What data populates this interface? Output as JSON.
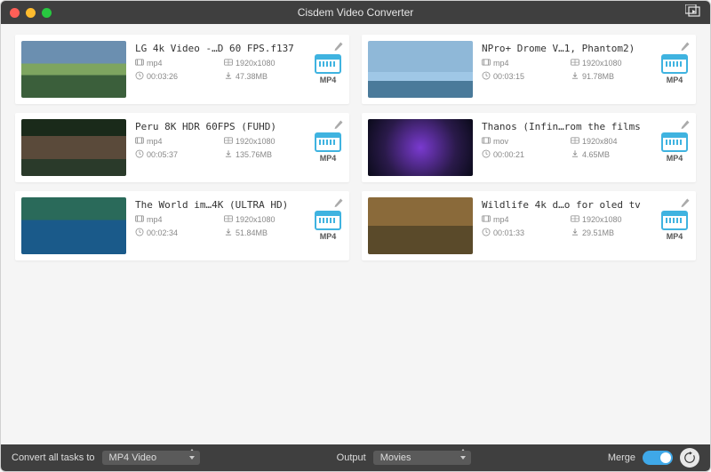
{
  "app": {
    "title": "Cisdem Video Converter"
  },
  "videos": [
    {
      "title": "LG 4k Video -…D 60 FPS.f137",
      "format": "mp4",
      "resolution": "1920x1080",
      "duration": "00:03:26",
      "size": "47.38MB",
      "target": "MP4"
    },
    {
      "title": "NPro+ Drome V…1, Phantom2)",
      "format": "mp4",
      "resolution": "1920x1080",
      "duration": "00:03:15",
      "size": "91.78MB",
      "target": "MP4"
    },
    {
      "title": "Peru 8K HDR 60FPS (FUHD)",
      "format": "mp4",
      "resolution": "1920x1080",
      "duration": "00:05:37",
      "size": "135.76MB",
      "target": "MP4"
    },
    {
      "title": "Thanos (Infin…rom the films",
      "format": "mov",
      "resolution": "1920x804",
      "duration": "00:00:21",
      "size": "4.65MB",
      "target": "MP4"
    },
    {
      "title": "The World im…4K (ULTRA HD)",
      "format": "mp4",
      "resolution": "1920x1080",
      "duration": "00:02:34",
      "size": "51.84MB",
      "target": "MP4"
    },
    {
      "title": "Wildlife 4k d…o for oled tv",
      "format": "mp4",
      "resolution": "1920x1080",
      "duration": "00:01:33",
      "size": "29.51MB",
      "target": "MP4"
    }
  ],
  "footer": {
    "convert_label": "Convert all tasks to",
    "convert_value": "MP4 Video",
    "output_label": "Output",
    "output_value": "Movies",
    "merge_label": "Merge"
  }
}
